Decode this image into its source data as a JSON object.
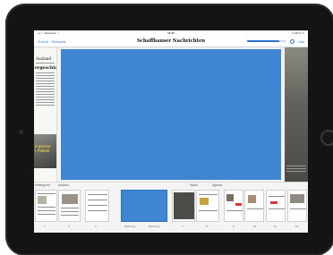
{
  "status_bar": {
    "carrier": "•••○○ Swisscom ⌔",
    "time": "12:47",
    "battery": "⊡ 38 % ▭"
  },
  "nav": {
    "back_label": "Zurück · Ressorts",
    "title": "Schaffhauser Nachrichten",
    "info_label": "Info",
    "progress": 0.8
  },
  "left_page": {
    "section": "Ausland",
    "headline": "ergeschla",
    "caption_lines": [
      "e grosse",
      "r Pakete"
    ]
  },
  "strip": {
    "labels": [
      "Hintergrund",
      "Ausland",
      "Inland",
      "Agenda"
    ],
    "thumb_labels": [
      "Werbung",
      "Werbung"
    ],
    "page_numbers": [
      "2",
      "3",
      "4",
      "5",
      "6",
      "7",
      "8",
      "9",
      "10",
      "11",
      "12",
      "13"
    ]
  },
  "colors": {
    "accent": "#2f7bd8",
    "page_fill": "#3f86d2"
  }
}
